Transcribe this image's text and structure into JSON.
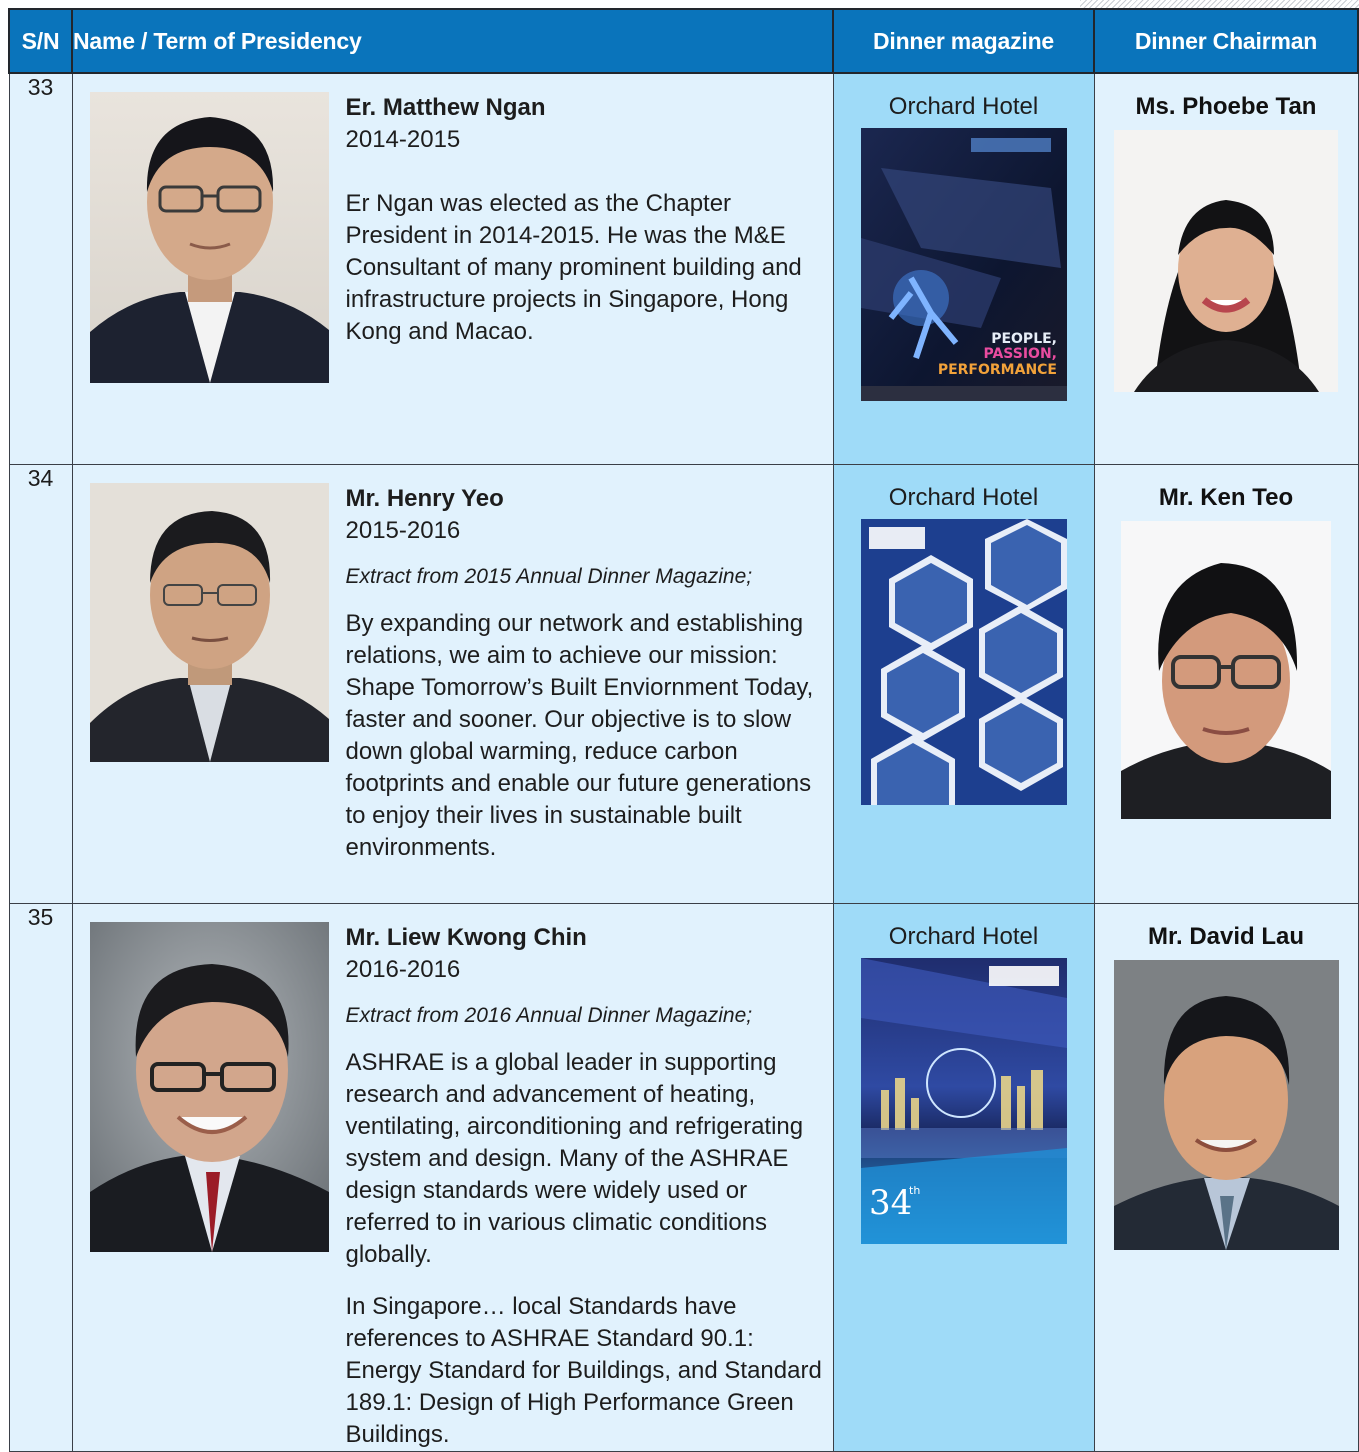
{
  "header": {
    "sn": "S/N",
    "name_term": "Name / Term of Presidency",
    "magazine": "Dinner magazine",
    "chairman": "Dinner Chairman"
  },
  "rows": [
    {
      "sn": "33",
      "president": "Er. Matthew Ngan",
      "term": "2014-2015",
      "paragraphs": [
        "Er Ngan was elected as the Chapter President in 2014-2015. He was the M&E Consultant of many prominent building and infrastructure projects in Singapore, Hong Kong and Macao."
      ],
      "venue": "Orchard Hotel",
      "magazine_cover_text": [
        "PEOPLE,",
        "PASSION,",
        "PERFORMANCE"
      ],
      "chairman": "Ms. Phoebe Tan"
    },
    {
      "sn": "34",
      "president": "Mr. Henry Yeo",
      "term": "2015-2016",
      "extract": "Extract from 2015 Annual Dinner Magazine;",
      "paragraphs": [
        "By expanding our network and establishing relations, we aim to achieve our mission: Shape Tomorrow’s Built Enviornment Today, faster and sooner. Our objective is to slow down global warming, reduce carbon footprints and enable our future generations to enjoy their lives in sustainable built environments."
      ],
      "venue": "Orchard Hotel",
      "chairman": "Mr. Ken Teo"
    },
    {
      "sn": "35",
      "president": "Mr. Liew Kwong Chin",
      "term": "2016-2016",
      "extract": "Extract from 2016 Annual Dinner Magazine;",
      "paragraphs": [
        "ASHRAE is a global leader in supporting research and advancement of heating, ventilating, airconditioning and refrigerating system and design. Many of the ASHRAE design standards were widely used or referred to in various climatic conditions globally.",
        "In Singapore… local Standards have references to ASHRAE Standard 90.1: Energy Standard for Buildings, and Standard 189.1: Design of High Performance Green Buildings."
      ],
      "venue": "Orchard Hotel",
      "magazine_cover_text": [
        "34",
        "th"
      ],
      "chairman": "Mr. David Lau"
    }
  ],
  "colors": {
    "header_bg": "#0a74bb",
    "row_bg": "#e1f2fd",
    "magazine_col_bg": "#9fdbf8"
  }
}
